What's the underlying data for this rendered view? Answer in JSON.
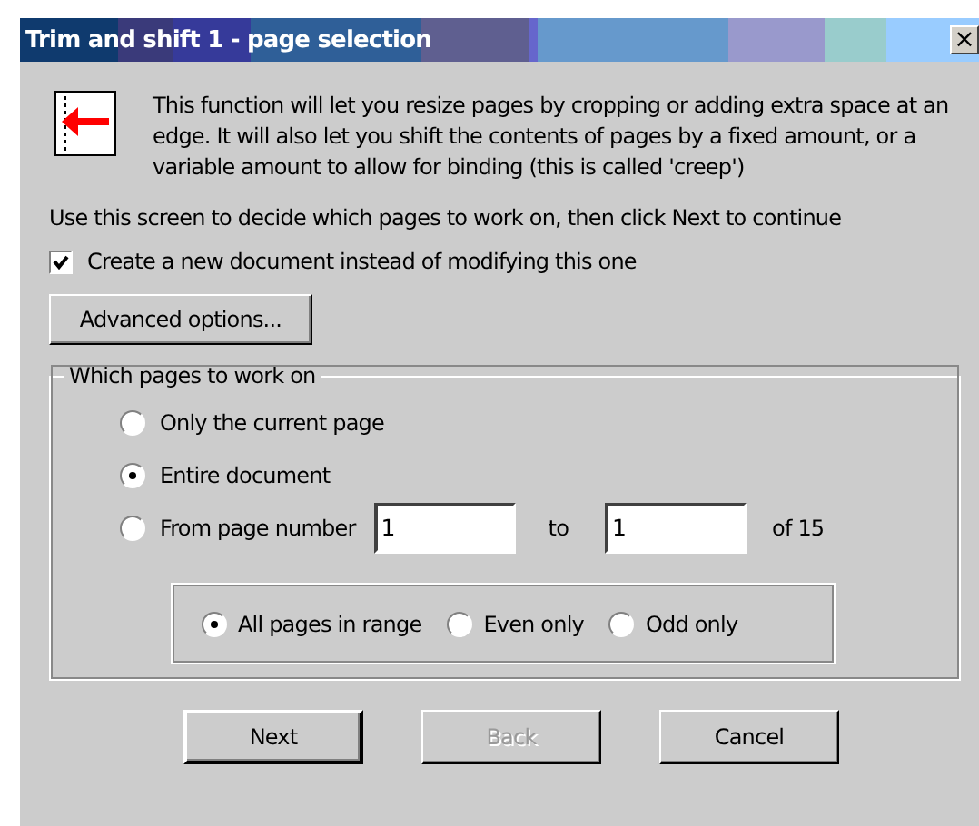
{
  "window": {
    "title": "Trim and shift 1 - page selection",
    "close": "×"
  },
  "intro": "This function will let you resize pages by cropping or adding extra space at an edge. It will also let you shift the contents of pages by a fixed amount, or a variable amount to allow for binding (this is called 'creep')",
  "instruction": "Use this screen to decide which pages to work on, then click Next to continue",
  "new_document": {
    "label": "Create a new document instead of modifying this one",
    "checked": true
  },
  "advanced_button": "Advanced options...",
  "pages_group": {
    "title": "Which pages to work on",
    "options": [
      {
        "label": "Only the current page",
        "selected": false
      },
      {
        "label": "Entire document",
        "selected": true
      },
      {
        "label": "From page number",
        "selected": false
      }
    ],
    "from": "1",
    "to_label": "to",
    "to": "1",
    "of_label": "of 15",
    "range_options": [
      {
        "label": "All pages in range",
        "selected": true
      },
      {
        "label": "Even only",
        "selected": false
      },
      {
        "label": "Odd only",
        "selected": false
      }
    ]
  },
  "buttons": [
    {
      "label": "Next",
      "disabled": false,
      "default": true
    },
    {
      "label": "Back",
      "disabled": true,
      "default": false
    },
    {
      "label": "Cancel",
      "disabled": false,
      "default": false
    }
  ]
}
